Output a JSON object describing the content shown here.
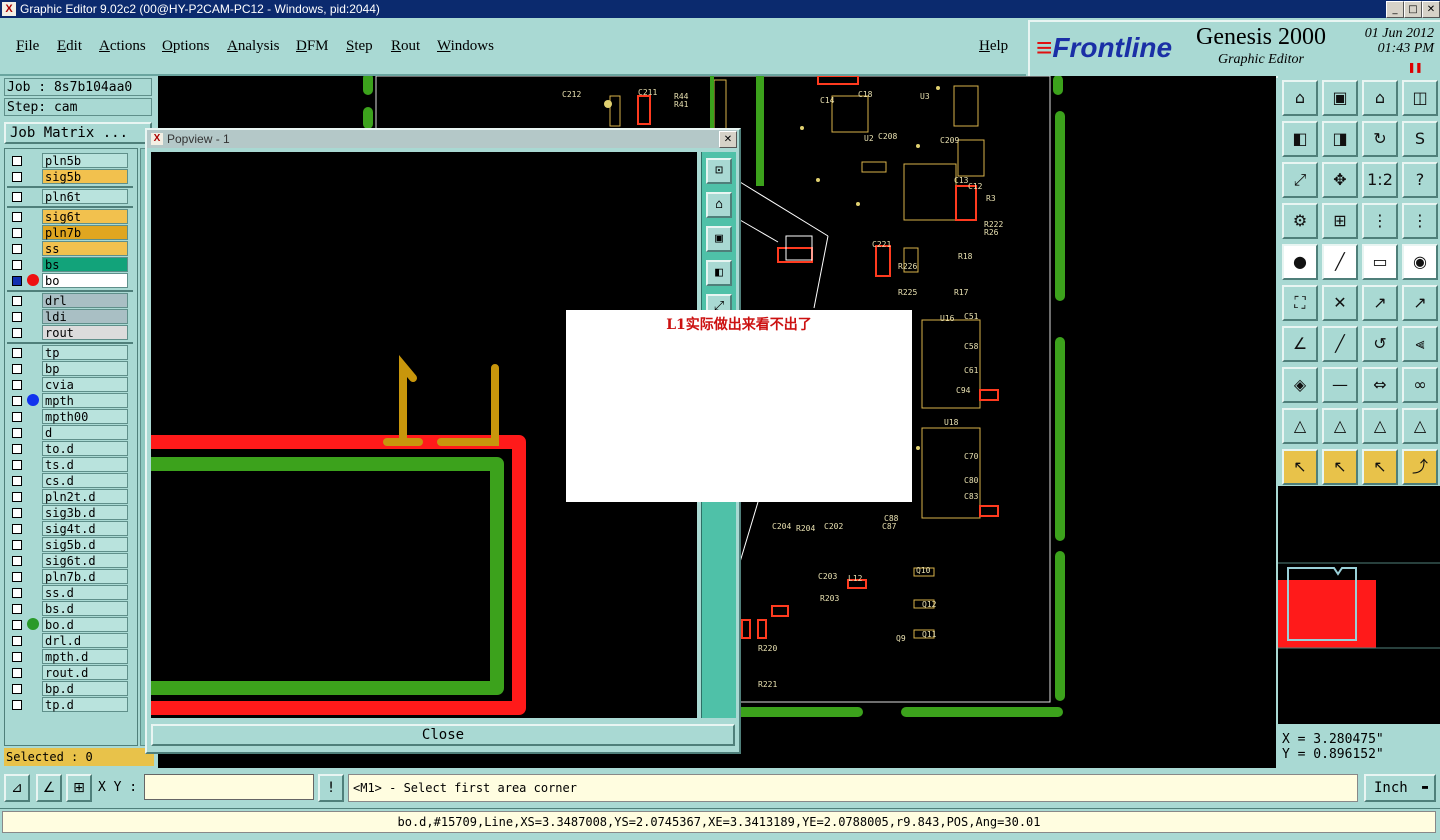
{
  "window": {
    "title": "Graphic Editor 9.02c2 (00@HY-P2CAM-PC12 - Windows, pid:2044)",
    "buttons": [
      "_",
      "□",
      "✕"
    ]
  },
  "menu": {
    "items": [
      "File",
      "Edit",
      "Actions",
      "Options",
      "Analysis",
      "DFM",
      "Step",
      "Rout",
      "Windows"
    ],
    "help": "Help"
  },
  "brand": {
    "logo_text": "Frontline",
    "product": "Genesis 2000",
    "subtitle": "Graphic Editor",
    "date": "01 Jun 2012",
    "time": "01:43 PM"
  },
  "job": {
    "job_label": "Job : 8s7b104aa0",
    "step_label": "Step: cam",
    "matrix_button": "Job Matrix ...",
    "selected": "Selected : 0"
  },
  "layers": [
    {
      "name": "pln5b",
      "bg": "#b9e3dd",
      "cb": false,
      "dot": "",
      "mark": ""
    },
    {
      "name": "sig5b",
      "bg": "#f2c14e",
      "cb": false,
      "dot": "",
      "mark": "✍"
    },
    {
      "name": "pln6t",
      "bg": "#b9e3dd",
      "cb": false,
      "dot": "",
      "mark": ""
    },
    {
      "name": "sig6t",
      "bg": "#f2c14e",
      "cb": false,
      "dot": "",
      "mark": ""
    },
    {
      "name": "pln7b",
      "bg": "#e0a620",
      "cb": false,
      "dot": "",
      "mark": ""
    },
    {
      "name": "ss",
      "bg": "#f2c14e",
      "cb": false,
      "dot": "",
      "mark": "✍"
    },
    {
      "name": "bs",
      "bg": "#12a37a",
      "cb": false,
      "dot": "",
      "mark": ""
    },
    {
      "name": "bo",
      "bg": "#ffffff",
      "cb": true,
      "dot": "#ee1111",
      "mark": "⊞"
    },
    {
      "name": "drl",
      "bg": "#a9bfc4",
      "cb": false,
      "dot": "",
      "mark": ""
    },
    {
      "name": "ldi",
      "bg": "#a9bfc4",
      "cb": false,
      "dot": "",
      "mark": ""
    },
    {
      "name": "rout",
      "bg": "#dcdcdc",
      "cb": false,
      "dot": "",
      "mark": ""
    },
    {
      "name": "tp",
      "bg": "#b9e3dd",
      "cb": false,
      "dot": "",
      "mark": ""
    },
    {
      "name": "bp",
      "bg": "#b9e3dd",
      "cb": false,
      "dot": "",
      "mark": ""
    },
    {
      "name": "cvia",
      "bg": "#b9e3dd",
      "cb": false,
      "dot": "",
      "mark": ""
    },
    {
      "name": "mpth",
      "bg": "#b9e3dd",
      "cb": false,
      "dot": "#1133ee",
      "mark": ""
    },
    {
      "name": "mpth00",
      "bg": "#b9e3dd",
      "cb": false,
      "dot": "",
      "mark": ""
    },
    {
      "name": "d",
      "bg": "#b9e3dd",
      "cb": false,
      "dot": "",
      "mark": ""
    },
    {
      "name": "to.d",
      "bg": "#b9e3dd",
      "cb": false,
      "dot": "",
      "mark": ""
    },
    {
      "name": "ts.d",
      "bg": "#b9e3dd",
      "cb": false,
      "dot": "",
      "mark": ""
    },
    {
      "name": "cs.d",
      "bg": "#b9e3dd",
      "cb": false,
      "dot": "",
      "mark": "✍"
    },
    {
      "name": "pln2t.d",
      "bg": "#b9e3dd",
      "cb": false,
      "dot": "",
      "mark": ""
    },
    {
      "name": "sig3b.d",
      "bg": "#b9e3dd",
      "cb": false,
      "dot": "",
      "mark": ""
    },
    {
      "name": "sig4t.d",
      "bg": "#b9e3dd",
      "cb": false,
      "dot": "",
      "mark": "✍"
    },
    {
      "name": "sig5b.d",
      "bg": "#b9e3dd",
      "cb": false,
      "dot": "",
      "mark": "✍"
    },
    {
      "name": "sig6t.d",
      "bg": "#b9e3dd",
      "cb": false,
      "dot": "",
      "mark": ""
    },
    {
      "name": "pln7b.d",
      "bg": "#b9e3dd",
      "cb": false,
      "dot": "",
      "mark": ""
    },
    {
      "name": "ss.d",
      "bg": "#b9e3dd",
      "cb": false,
      "dot": "",
      "mark": "✍"
    },
    {
      "name": "bs.d",
      "bg": "#b9e3dd",
      "cb": false,
      "dot": "",
      "mark": ""
    },
    {
      "name": "bo.d",
      "bg": "#b9e3dd",
      "cb": false,
      "dot": "#2a9a2a",
      "mark": ""
    },
    {
      "name": "drl.d",
      "bg": "#b9e3dd",
      "cb": false,
      "dot": "",
      "mark": ""
    },
    {
      "name": "mpth.d",
      "bg": "#b9e3dd",
      "cb": false,
      "dot": "",
      "mark": ""
    },
    {
      "name": "rout.d",
      "bg": "#b9e3dd",
      "cb": false,
      "dot": "",
      "mark": ""
    },
    {
      "name": "bp.d",
      "bg": "#b9e3dd",
      "cb": false,
      "dot": "",
      "mark": ""
    },
    {
      "name": "tp.d",
      "bg": "#b9e3dd",
      "cb": false,
      "dot": "",
      "mark": ""
    }
  ],
  "popview": {
    "title": "Popview - 1",
    "close_x": "✕",
    "close_button": "Close"
  },
  "note": {
    "text": "L1实际做出来看不出了"
  },
  "tools": [
    {
      "name": "home-icon",
      "glyph": "⌂",
      "style": ""
    },
    {
      "name": "window-icon",
      "glyph": "▣",
      "style": ""
    },
    {
      "name": "zoom-home-icon",
      "glyph": "⌂",
      "style": ""
    },
    {
      "name": "split-view-icon",
      "glyph": "◫",
      "style": ""
    },
    {
      "name": "pan-left-icon",
      "glyph": "◧",
      "style": ""
    },
    {
      "name": "pan-right-icon",
      "glyph": "◨",
      "style": ""
    },
    {
      "name": "redo-icon",
      "glyph": "↻",
      "style": ""
    },
    {
      "name": "snap-icon",
      "glyph": "S",
      "style": ""
    },
    {
      "name": "fit-icon",
      "glyph": "⤢",
      "style": ""
    },
    {
      "name": "center-icon",
      "glyph": "✥",
      "style": ""
    },
    {
      "name": "scale-1-2-icon",
      "glyph": "1:2",
      "style": ""
    },
    {
      "name": "help-icon",
      "glyph": "?",
      "style": ""
    },
    {
      "name": "tools-icon",
      "glyph": "⚙",
      "style": ""
    },
    {
      "name": "grid-icon",
      "glyph": "⊞",
      "style": ""
    },
    {
      "name": "traffic-icon",
      "glyph": "⋮",
      "style": ""
    },
    {
      "name": "net-icon",
      "glyph": "⋮",
      "style": ""
    },
    {
      "name": "pad-icon",
      "glyph": "●",
      "style": "white"
    },
    {
      "name": "draw-line-icon",
      "glyph": "╱",
      "style": "white"
    },
    {
      "name": "ruler-icon",
      "glyph": "▭",
      "style": "white"
    },
    {
      "name": "dot-icon",
      "glyph": "◉",
      "style": "white"
    },
    {
      "name": "connect-icon",
      "glyph": "⛶",
      "style": ""
    },
    {
      "name": "cross-icon",
      "glyph": "✕",
      "style": ""
    },
    {
      "name": "move-icon",
      "glyph": "↗",
      "style": ""
    },
    {
      "name": "copy-icon",
      "glyph": "↗",
      "style": ""
    },
    {
      "name": "angle-icon",
      "glyph": "∠",
      "style": ""
    },
    {
      "name": "slash-icon",
      "glyph": "╱",
      "style": ""
    },
    {
      "name": "arc-icon",
      "glyph": "↺",
      "style": ""
    },
    {
      "name": "mirror-icon",
      "glyph": "⫷",
      "style": ""
    },
    {
      "name": "select-icon",
      "glyph": "◈",
      "style": ""
    },
    {
      "name": "minus-icon",
      "glyph": "—",
      "style": ""
    },
    {
      "name": "measure-icon",
      "glyph": "⇔",
      "style": ""
    },
    {
      "name": "circles-icon",
      "glyph": "∞",
      "style": ""
    },
    {
      "name": "triangle-1-icon",
      "glyph": "△",
      "style": ""
    },
    {
      "name": "triangle-2-icon",
      "glyph": "△",
      "style": ""
    },
    {
      "name": "triangle-3-icon",
      "glyph": "△",
      "style": ""
    },
    {
      "name": "triangle-4-icon",
      "glyph": "△",
      "style": ""
    },
    {
      "name": "pointer-icon",
      "glyph": "↖",
      "style": "yel"
    },
    {
      "name": "pointer-box-icon",
      "glyph": "↖",
      "style": "yel"
    },
    {
      "name": "pointer-diamond-icon",
      "glyph": "↖",
      "style": "yel"
    },
    {
      "name": "route-icon",
      "glyph": "⤴",
      "style": "yel"
    }
  ],
  "coords": {
    "x": "X = 3.280475\"",
    "y": "Y = 0.896152\""
  },
  "command": {
    "xy_label": "X Y :",
    "xy_value": "",
    "prompt": "<M1> - Select first area corner",
    "units": "Inch",
    "status": "bo.d,#15709,Line,XS=3.3487008,YS=2.0745367,XE=3.3413189,YE=2.0788005,r9.843,POS,Ang=30.01"
  },
  "pcb_labels": [
    "C212",
    "C211",
    "R44",
    "R41",
    "C14",
    "C18",
    "U3",
    "U2",
    "C208",
    "C209",
    "C13",
    "C12",
    "R3",
    "R222",
    "R26",
    "C221",
    "R226",
    "R225",
    "R18",
    "R17",
    "U16",
    "C94",
    "U18",
    "C88",
    "C87",
    "C203",
    "C202",
    "R203",
    "C204",
    "R204",
    "L12",
    "R220",
    "R221",
    "Q10",
    "Q12",
    "Q11",
    "Q9",
    "C51",
    "C58",
    "C61",
    "C70",
    "C80",
    "C83"
  ]
}
